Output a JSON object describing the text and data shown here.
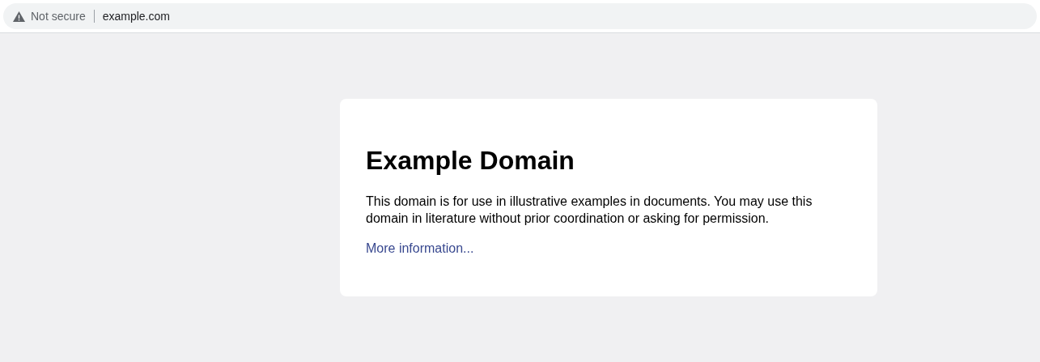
{
  "address_bar": {
    "security": "Not secure",
    "url": "example.com"
  },
  "card": {
    "title": "Example Domain",
    "text": "This domain is for use in illustrative examples in documents. You may use this domain in literature without prior coordination or asking for permission.",
    "link": "More information..."
  }
}
